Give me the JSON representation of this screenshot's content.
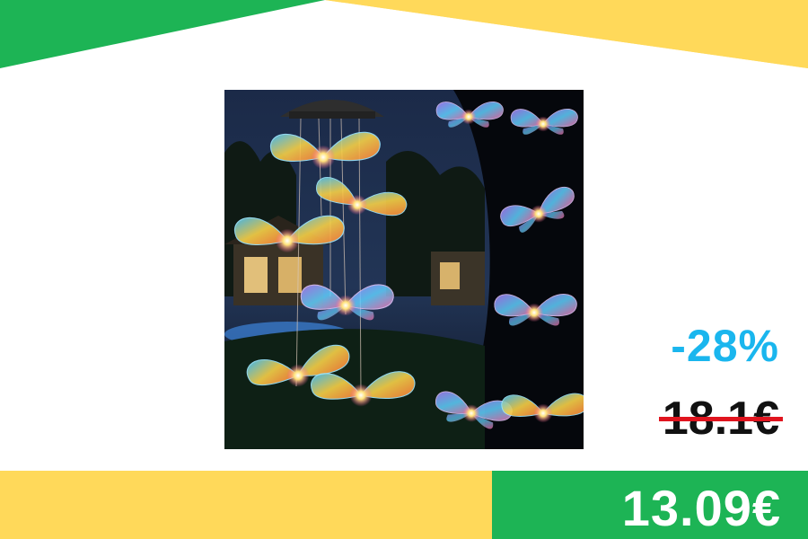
{
  "product": {
    "image_alt": "Solar butterfly wind chime with color-changing LED lights"
  },
  "pricing": {
    "discount": "-28%",
    "old_price": "18.1€",
    "new_price": "13.09€"
  },
  "colors": {
    "green": "#1db455",
    "yellow": "#ffd95a",
    "discount_blue": "#1ab6ee",
    "strike_red": "#e0141e"
  }
}
